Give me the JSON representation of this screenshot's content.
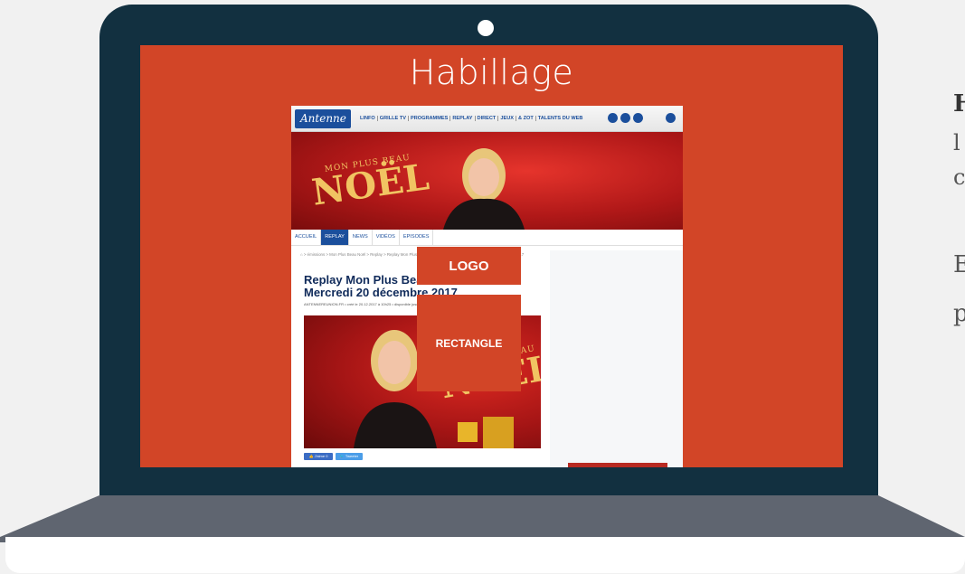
{
  "screen": {
    "title": "Habillage"
  },
  "site": {
    "brand": "Antenne",
    "top_nav": [
      "LINFO",
      "GRILLE TV",
      "PROGRAMMES",
      "REPLAY",
      "DIRECT",
      "JEUX",
      "& ZOT",
      "TALENTS DU WEB"
    ],
    "hero": {
      "show_subtitle": "MON PLUS BEAU",
      "show_title": "NOËL"
    },
    "section_nav": [
      "ACCUEIL",
      "REPLAY",
      "NEWS",
      "VIDÉOS",
      "EPISODES"
    ],
    "breadcrumb": "⌂ > émissions > Mon Plus Beau Noël > Replay > Replay Mon Plus Beau Noël - Patrice et Arnaud - Mercredi 20 décembre 2017",
    "article": {
      "title": "Replay Mon Plus Beau Noël - Patrice Mercredi 20 décembre 2017",
      "meta": "ANTENNEREUNION.FR • créé le 20.12.2017 à 10h25 • disponible jusqu'au ... à 0h0"
    },
    "thumbnail": {
      "show_subtitle": "MON PLUS BEAU",
      "show_title": "NOËL"
    },
    "share": {
      "facebook": "👍 J'aime 0",
      "twitter": "🐦 Tweeter"
    }
  },
  "ads": {
    "logo_label": "LOGO",
    "rectangle_label": "RECTANGLE"
  },
  "side_text": {
    "line1": "H",
    "line2": "l",
    "line3": "c",
    "line4": "E",
    "line5": "p"
  },
  "colors": {
    "accent": "#d24527",
    "laptop": "#123040",
    "brand_blue": "#1b4f9c"
  }
}
